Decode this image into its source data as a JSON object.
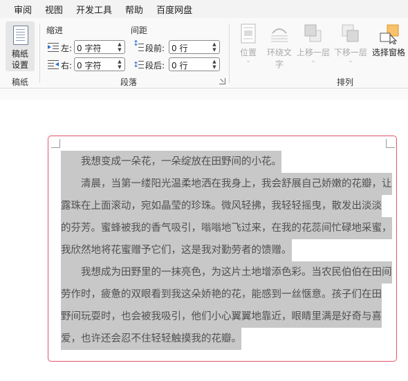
{
  "menubar": {
    "items": [
      "审阅",
      "视图",
      "开发工具",
      "帮助",
      "百度网盘"
    ]
  },
  "ribbon": {
    "manuscript": {
      "label_line1": "稿纸",
      "label_line2": "设置",
      "group_label": "稿纸"
    },
    "paragraph": {
      "group_label": "段落",
      "indent_header": "缩进",
      "spacing_header": "间距",
      "left_label": "左:",
      "left_value": "0 字符",
      "right_label": "右:",
      "right_value": "0 字符",
      "before_label": "段前:",
      "before_value": "0 行",
      "after_label": "段后:",
      "after_value": "0 行"
    },
    "arrange": {
      "group_label": "排列",
      "position": "位置",
      "wrap_text_line1": "环绕文",
      "wrap_text_line2": "字",
      "bring_forward": "上移一层",
      "send_backward": "下移一层",
      "selection_pane": "选择窗格"
    }
  },
  "document": {
    "lines": [
      "　　我想变成一朵花，一朵绽放在田野间的小花。",
      "　　清晨，当第一缕阳光温柔地洒在我身上，我会舒展自己娇嫩的花瓣，让",
      "露珠在上面滚动，宛如晶莹的珍珠。微风轻拂，我轻轻摇曳，散发出淡淡",
      "的芬芳。蜜蜂被我的香气吸引，嗡嗡地飞过来，在我的花蕊间忙碌地采蜜，",
      "我欣然地将花蜜赠予它们，这是我对勤劳者的馈赠。",
      "　　我想成为田野里的一抹亮色，为这片土地增添色彩。当农民伯伯在田间",
      "劳作时，疲惫的双眼看到我这朵娇艳的花，能感到一丝惬意。孩子们在田",
      "野间玩耍时，也会被我吸引，他们小心翼翼地靠近，眼睛里满是好奇与喜",
      "爱，也许还会忍不住轻轻触摸我的花瓣。"
    ]
  },
  "colors": {
    "selection_border": "#e2546a",
    "text_highlight": "#c8c8c8",
    "selection_pane_icon": "#f7c26b"
  }
}
